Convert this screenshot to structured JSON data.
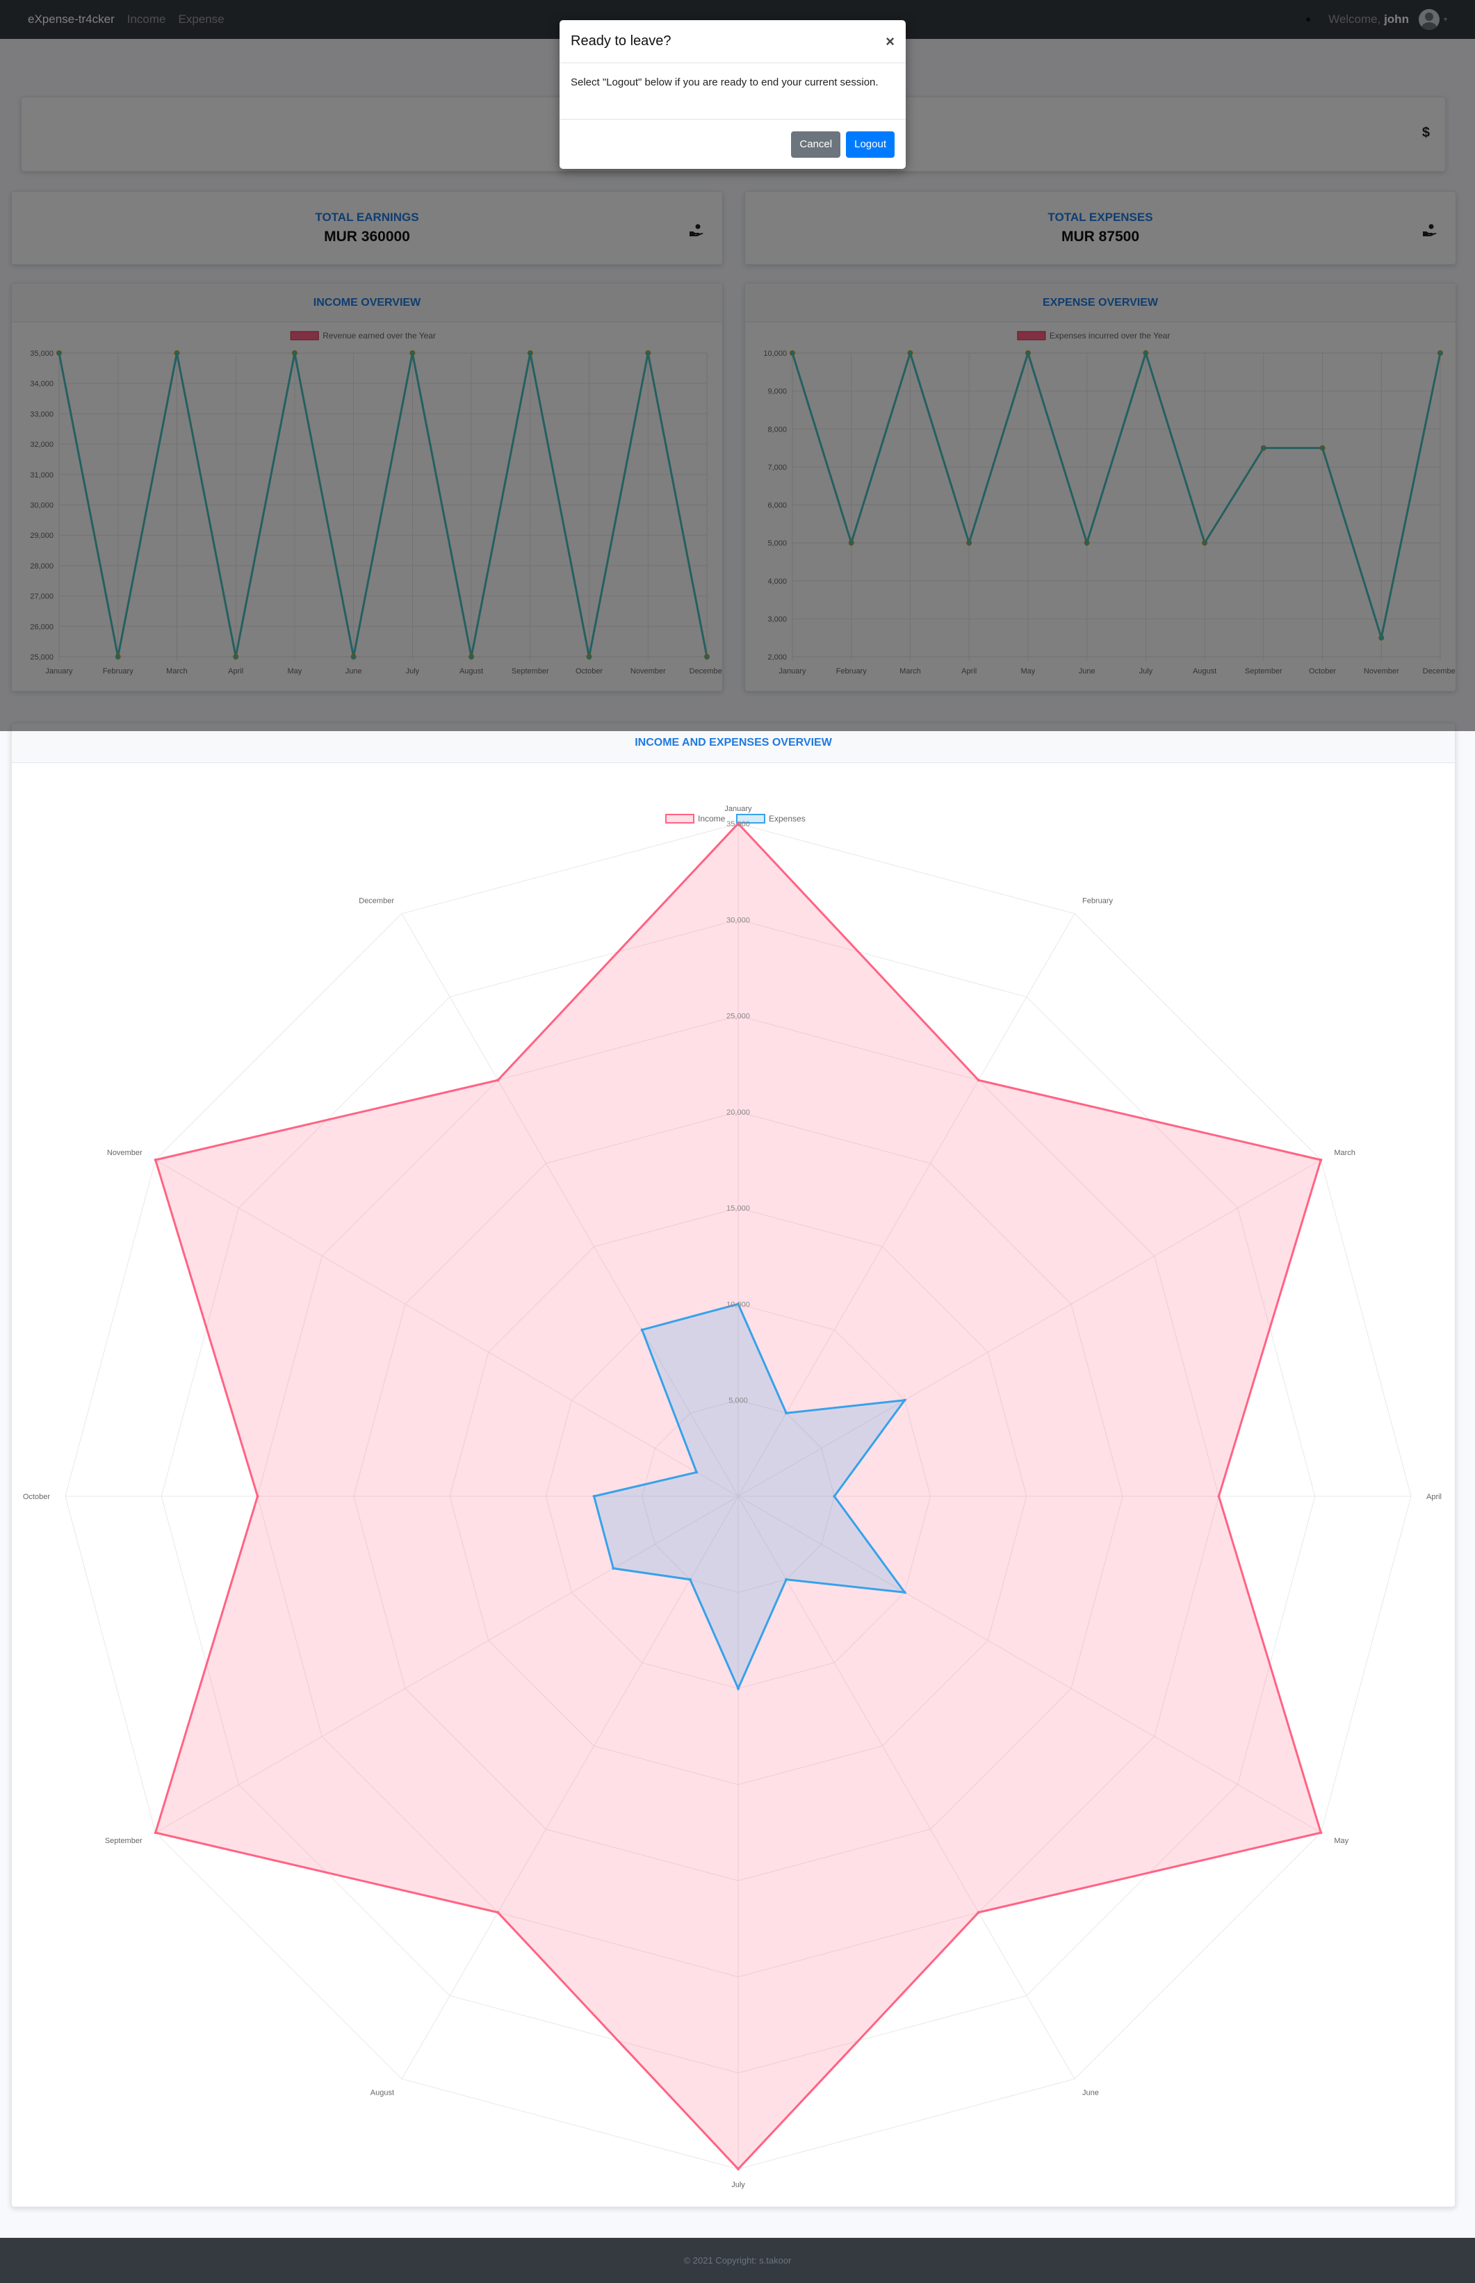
{
  "navbar": {
    "brand": "eXpense-tr4cker",
    "links": [
      "Income",
      "Expense"
    ],
    "welcome_prefix": "Welcome,",
    "username": "john"
  },
  "top_card": {
    "currency_icon": "$"
  },
  "stats": {
    "earnings": {
      "title": "TOTAL EARNINGS",
      "value": "MUR 360000",
      "icon": "hand-holding-usd-icon"
    },
    "expenses": {
      "title": "TOTAL EXPENSES",
      "value": "MUR 87500",
      "icon": "hand-holding-usd-icon"
    }
  },
  "panels": {
    "income_title": "INCOME OVERVIEW",
    "expense_title": "EXPENSE OVERVIEW",
    "combined_title": "INCOME AND EXPENSES OVERVIEW"
  },
  "modal": {
    "title": "Ready to leave?",
    "close": "×",
    "body": "Select \"Logout\" below if you are ready to end your current session.",
    "cancel": "Cancel",
    "logout": "Logout"
  },
  "footer": {
    "text": "© 2021 Copyright: s.takoor"
  },
  "chart_data": [
    {
      "type": "line",
      "categories": [
        "January",
        "February",
        "March",
        "April",
        "May",
        "June",
        "July",
        "August",
        "September",
        "October",
        "November",
        "December"
      ],
      "series": [
        {
          "name": "Revenue earned over the Year",
          "values": [
            35000,
            25000,
            35000,
            25000,
            35000,
            25000,
            35000,
            25000,
            35000,
            25000,
            35000,
            25000
          ]
        }
      ],
      "ylim": [
        25000,
        35000
      ],
      "yticks": [
        25000,
        26000,
        27000,
        28000,
        29000,
        30000,
        31000,
        32000,
        33000,
        34000,
        35000
      ],
      "ytick_labels": [
        "25,000",
        "26,000",
        "27,000",
        "28,000",
        "29,000",
        "30,000",
        "31,000",
        "32,000",
        "33,000",
        "34,000",
        "35,000"
      ],
      "color": "#4bc0c0",
      "grid": true,
      "legend": "top-center"
    },
    {
      "type": "line",
      "categories": [
        "January",
        "February",
        "March",
        "April",
        "May",
        "June",
        "July",
        "August",
        "September",
        "October",
        "November",
        "December"
      ],
      "series": [
        {
          "name": "Expenses incurred over the Year",
          "values": [
            10000,
            5000,
            10000,
            5000,
            10000,
            5000,
            10000,
            5000,
            7500,
            7500,
            2500,
            10000
          ]
        }
      ],
      "ylim": [
        2000,
        10000
      ],
      "yticks": [
        2000,
        3000,
        4000,
        5000,
        6000,
        7000,
        8000,
        9000,
        10000
      ],
      "ytick_labels": [
        "2,000",
        "3,000",
        "4,000",
        "5,000",
        "6,000",
        "7,000",
        "8,000",
        "9,000",
        "10,000"
      ],
      "color": "#4bc0c0",
      "grid": true,
      "legend": "top-center"
    },
    {
      "type": "radar",
      "categories": [
        "January",
        "February",
        "March",
        "April",
        "May",
        "June",
        "July",
        "August",
        "September",
        "October",
        "November",
        "December"
      ],
      "series": [
        {
          "name": "Income",
          "values": [
            35000,
            25000,
            35000,
            25000,
            35000,
            25000,
            35000,
            25000,
            35000,
            25000,
            35000,
            25000
          ],
          "color": "#ff6384"
        },
        {
          "name": "Expenses",
          "values": [
            10000,
            5000,
            10000,
            5000,
            10000,
            5000,
            10000,
            5000,
            7500,
            7500,
            2500,
            10000
          ],
          "color": "#36a2eb"
        }
      ],
      "rmax": 35000,
      "rticks": [
        5000,
        10000,
        15000,
        20000,
        25000,
        30000,
        35000
      ],
      "rtick_labels": [
        "5,000",
        "10,000",
        "15,000",
        "20,000",
        "25,000",
        "30,000",
        "35,000"
      ],
      "legend": "top-center"
    }
  ]
}
